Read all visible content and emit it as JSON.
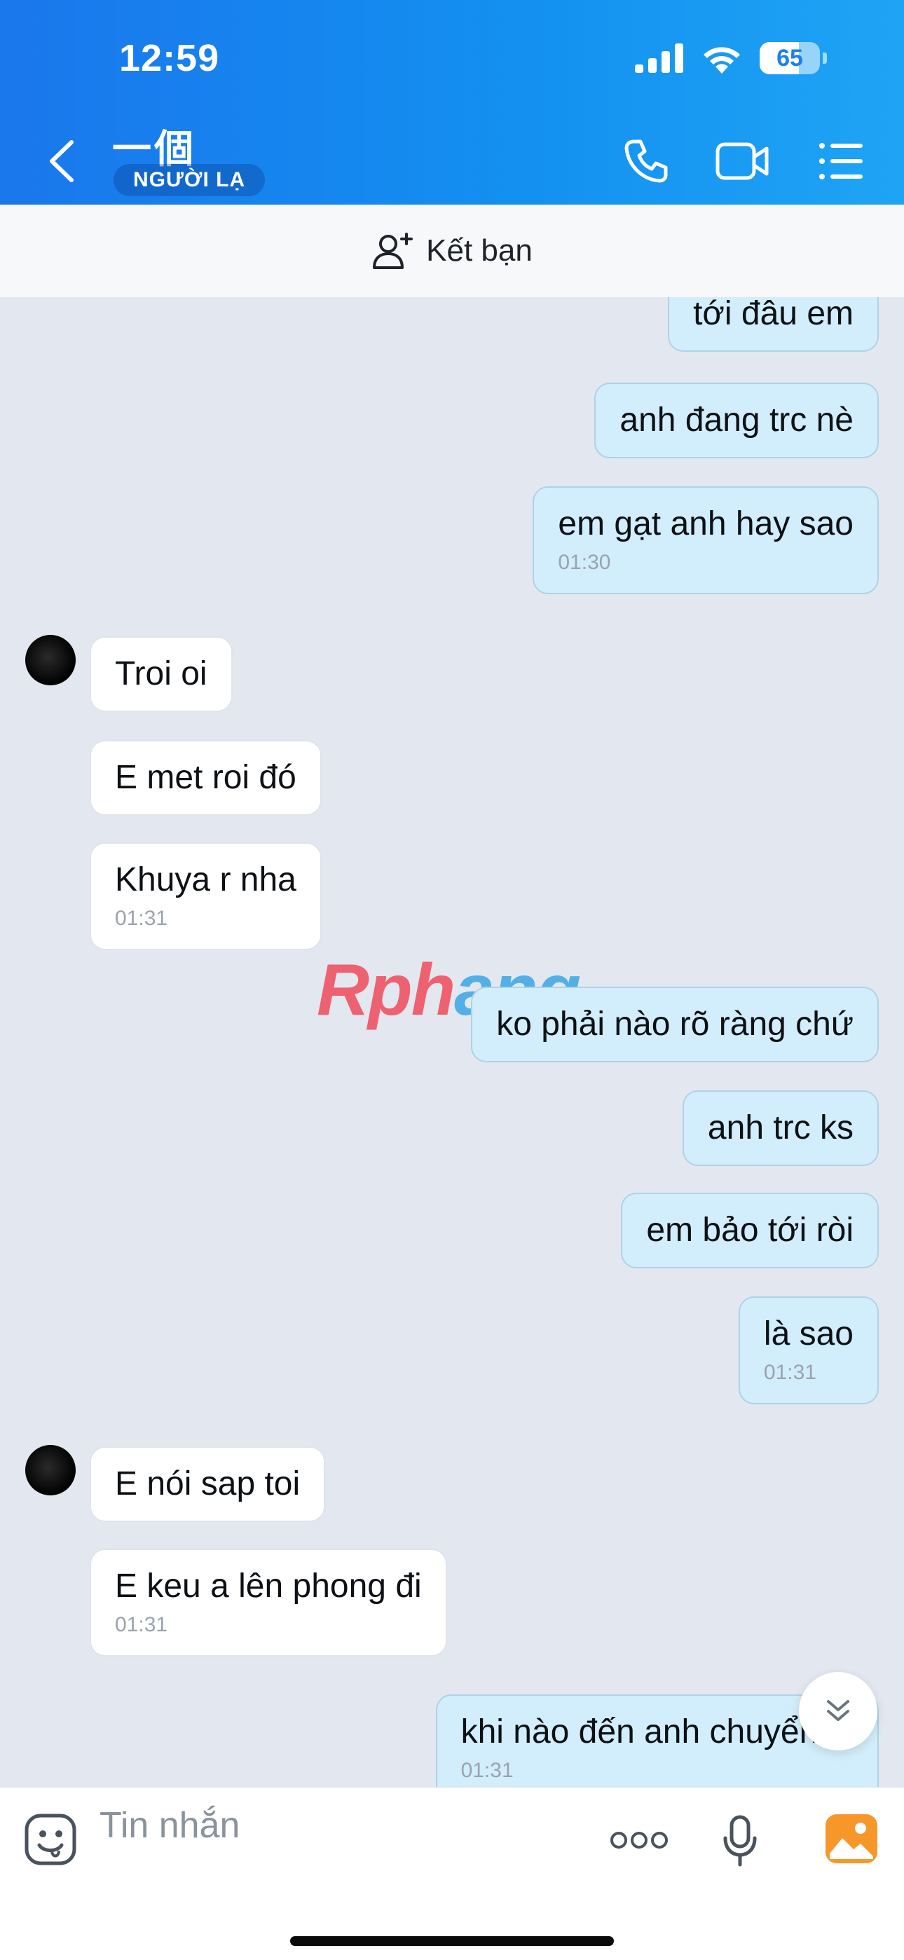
{
  "status_bar": {
    "time": "12:59",
    "battery": "65",
    "battery_level": 0.65
  },
  "header": {
    "contact_name": "一個",
    "badge": "NGƯỜI LẠ"
  },
  "friend_bar": {
    "label": "Kết bạn"
  },
  "messages": [
    {
      "text": "tới đâu em",
      "time": ""
    },
    {
      "text": "anh đang trc nè",
      "time": ""
    },
    {
      "text": "em gạt anh hay sao",
      "time": "01:30"
    },
    {
      "text": "Troi oi",
      "time": ""
    },
    {
      "text": "E met roi đó",
      "time": ""
    },
    {
      "text": "Khuya r nha",
      "time": "01:31"
    },
    {
      "text": "ko phải nào rõ ràng chứ",
      "time": ""
    },
    {
      "text": "anh trc ks",
      "time": ""
    },
    {
      "text": "em bảo tới ròi",
      "time": ""
    },
    {
      "text": "là sao",
      "time": "01:31"
    },
    {
      "text": "E nói sap toi",
      "time": ""
    },
    {
      "text": "E keu a lên phong đi",
      "time": "01:31"
    },
    {
      "text": "khi nào đến anh chuyển đi",
      "time": "01:31"
    }
  ],
  "watermark": {
    "part1": "Rph",
    "part2": "ang"
  },
  "input": {
    "placeholder": "Tin nhắn"
  },
  "colors": {
    "header_start": "#1a77ec",
    "header_end": "#1ea4f5",
    "my_bubble": "#d2edfb",
    "other_bubble": "#ffffff",
    "chat_bg": "#e3e8f0"
  }
}
